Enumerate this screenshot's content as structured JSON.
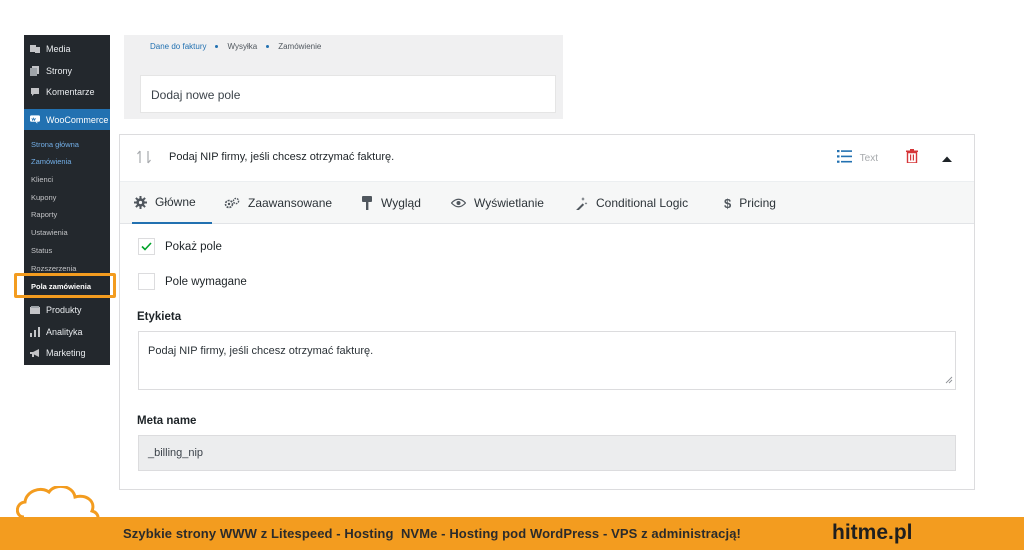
{
  "sidebar": {
    "media": "Media",
    "pages": "Strony",
    "comments": "Komentarze",
    "woocommerce": "WooCommerce",
    "sub": [
      "Strona główna",
      "Zamówienia",
      "Klienci",
      "Kupony",
      "Raporty",
      "Ustawienia",
      "Status",
      "Rozszerzenia",
      "Pola zamówienia"
    ],
    "products": "Produkty",
    "analytics": "Analityka",
    "marketing": "Marketing"
  },
  "breadcrumbs": [
    "Dane do faktury",
    "Wysyłka",
    "Zamówienie"
  ],
  "add_field": "Dodaj nowe pole",
  "field": {
    "title": "Podaj NIP firmy, jeśli chcesz otrzymać fakturę.",
    "type": "Text"
  },
  "tabs": [
    "Główne",
    "Zaawansowane",
    "Wygląd",
    "Wyświetlanie",
    "Conditional Logic",
    "Pricing"
  ],
  "options": {
    "show_field": "Pokaż pole",
    "required": "Pole wymagane"
  },
  "label_section": {
    "label": "Etykieta",
    "value": "Podaj NIP firmy, jeśli chcesz otrzymać fakturę."
  },
  "meta_section": {
    "label": "Meta name",
    "value": "_billing_nip"
  },
  "banner": {
    "text": "Szybkie strony WWW z Litespeed - Hosting  NVMe - Hosting pod WordPress - VPS z administracją!",
    "brand": "hitme.pl"
  },
  "colors": {
    "sidebar_bg": "#23282d",
    "woo_accent": "#2271b1",
    "highlight": "#f39c1f",
    "delete_red": "#d63638",
    "banner_bg": "#f39c1f"
  }
}
